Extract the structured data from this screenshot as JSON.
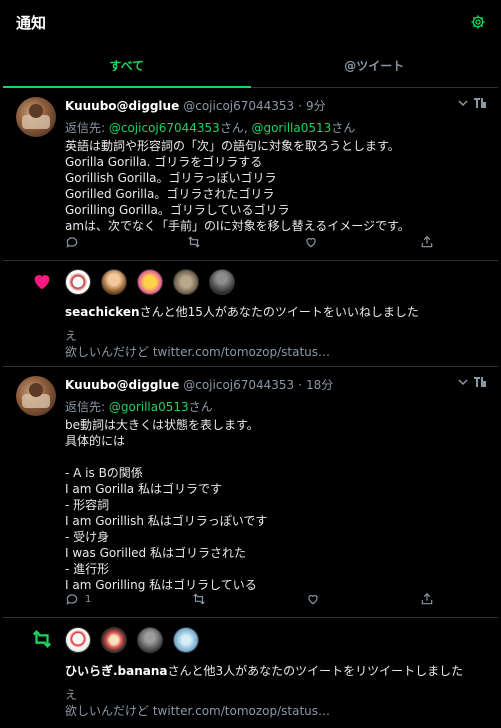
{
  "header": {
    "title": "通知"
  },
  "tabs": [
    {
      "label": "すべて"
    },
    {
      "label": "@ツイート"
    }
  ],
  "tweets": [
    {
      "display_name": "Kuuubo@digglue",
      "handle": "@cojicoj67044353",
      "dot": "·",
      "time": "9分",
      "reply_prefix": "返信先: ",
      "reply_mention1": "@cojicoj67044353",
      "reply_sep": "さん, ",
      "reply_mention2": "@gorilla0513",
      "reply_suffix": "さん",
      "text": "英語は動詞や形容詞の「次」の語句に対象を取ろうとします。\nGorilla Gorilla. ゴリラをゴリラする\nGorillish Gorilla。ゴリラっぽいゴリラ\nGorilled Gorilla。ゴリラされたゴリラ\nGorilling Gorilla。ゴリラしているゴリラ\namは、次でなく「手前」のIに対象を移し替えるイメージです。",
      "reply_count": ""
    },
    {
      "display_name": "Kuuubo@digglue",
      "handle": "@cojicoj67044353",
      "dot": "·",
      "time": "18分",
      "reply_prefix": "返信先: ",
      "reply_mention1": "@gorilla0513",
      "reply_suffix": "さん",
      "text": "be動詞は大きくは状態を表します。\n具体的には\n\n- A is Bの関係\nI am Gorilla 私はゴリラです\n- 形容詞\nI am Gorillish  私はゴリラっぽいです\n- 受け身\nI was Gorilled  私はゴリラされた\n- 進行形\nI am Gorilling  私はゴリラしている",
      "reply_count": "1"
    }
  ],
  "notifications": [
    {
      "type": "like",
      "user": "seachicken",
      "suffix": "さんと他15人があなたのツイートをいいねしました",
      "quote_line1": "え",
      "quote_line2": "欲しいんだけど twitter.com/tomozop/status…"
    },
    {
      "type": "retweet",
      "user": "ひいらぎ.banana",
      "suffix": "さんと他3人があなたのツイートをリツイートしました",
      "quote_line1": "え",
      "quote_line2": "欲しいんだけど twitter.com/tomozop/status…"
    }
  ],
  "colors": {
    "accent": "#1bd35f",
    "like": "#f91880",
    "background": "#000000",
    "muted": "#8b98a5",
    "border": "#2f3336"
  }
}
